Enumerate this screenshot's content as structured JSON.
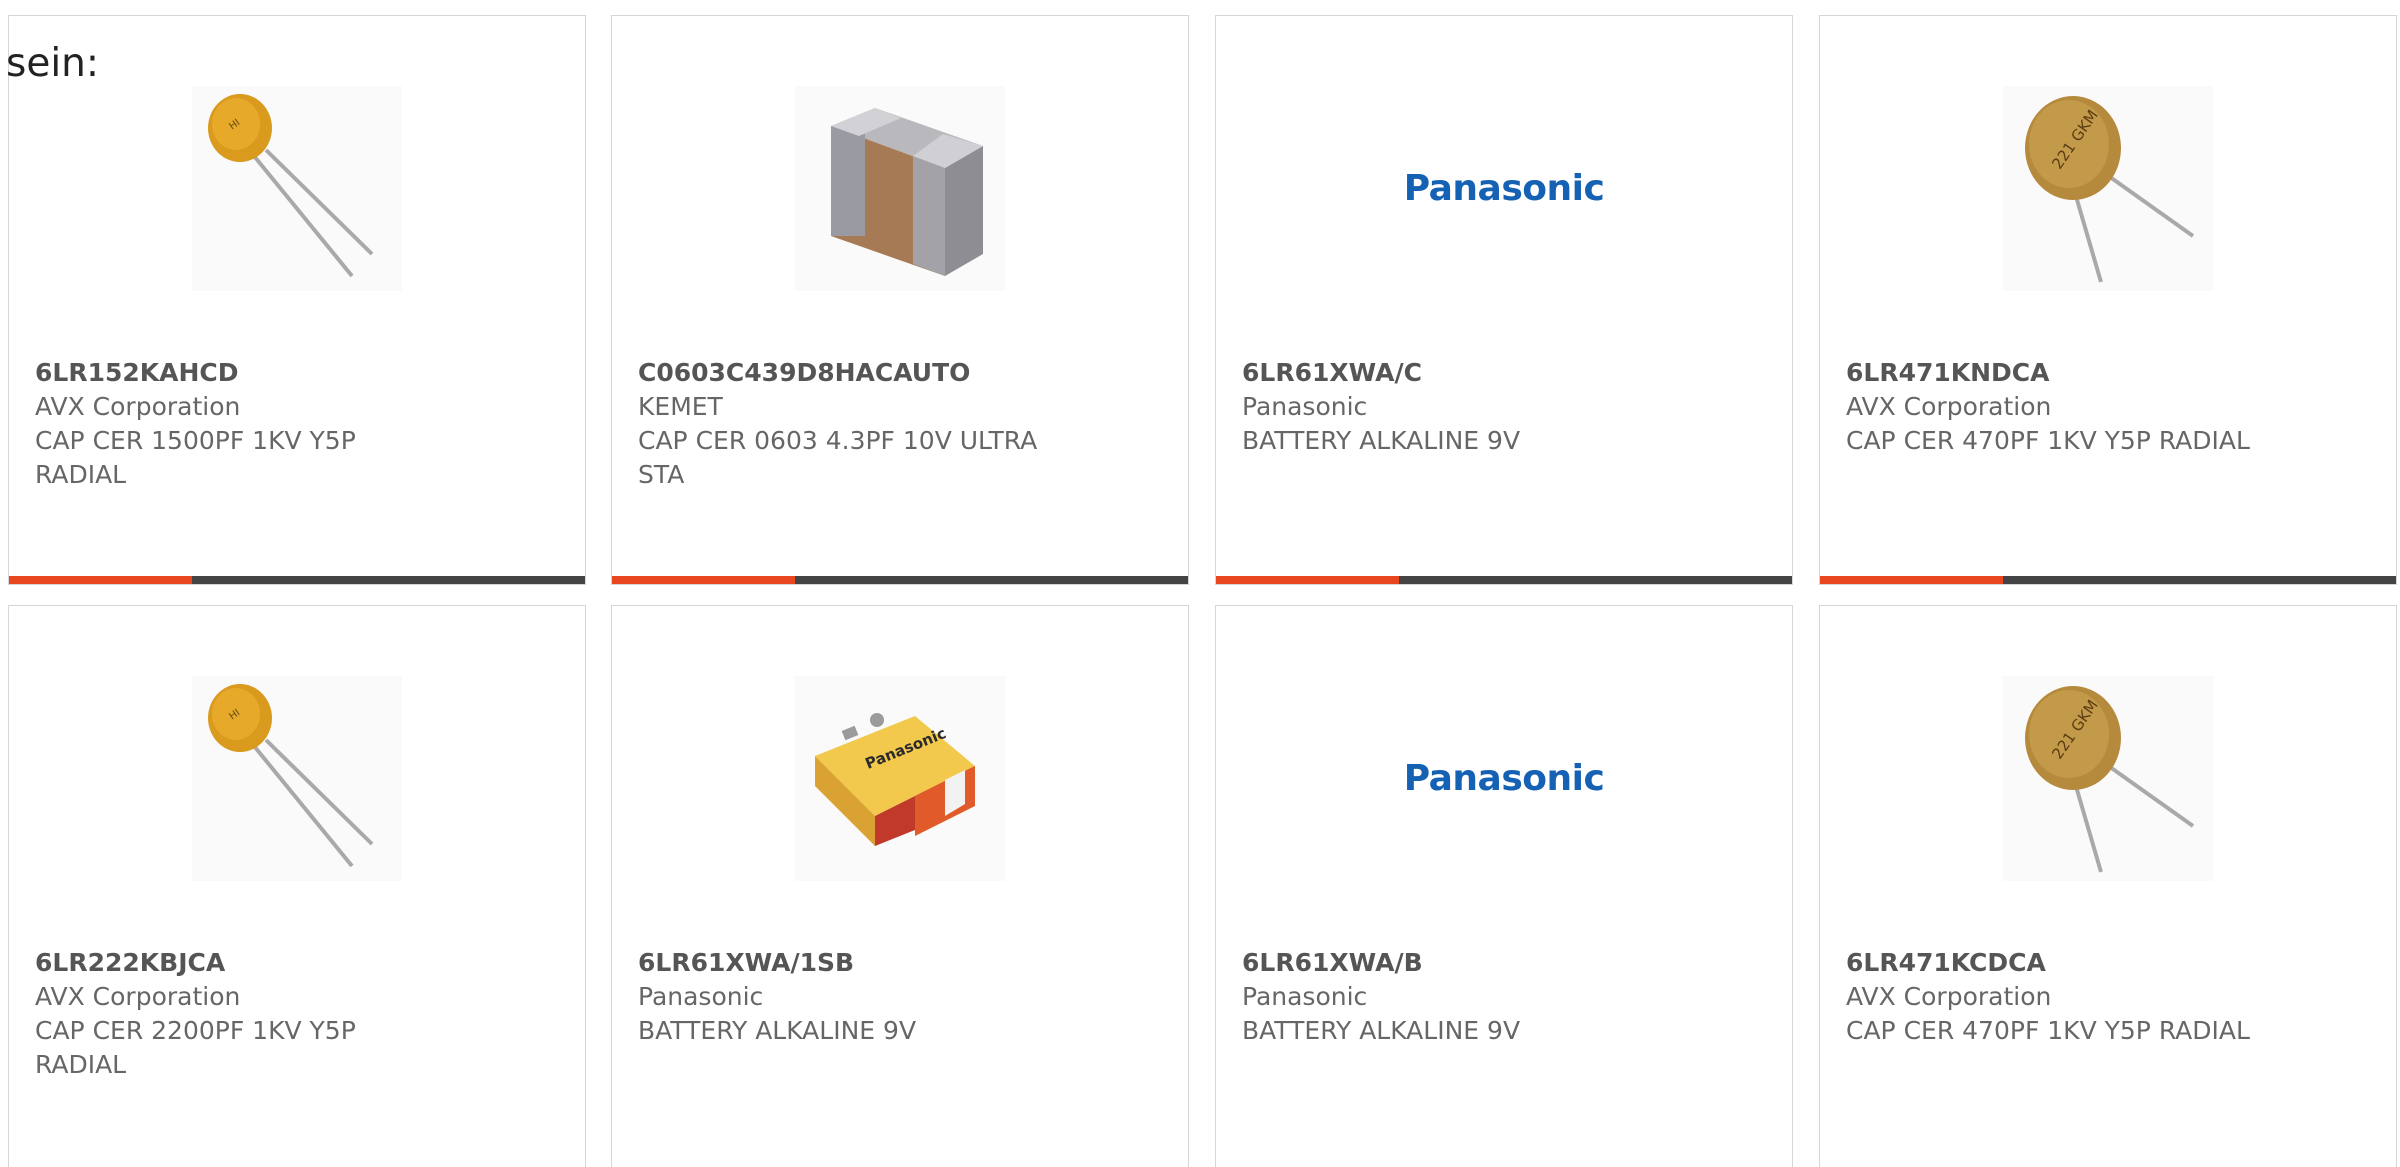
{
  "intro_text": "sein:",
  "colors": {
    "accent": "#e8461f",
    "bar_dark": "#444444",
    "panasonic_blue": "#1561b3"
  },
  "cards": [
    {
      "part": "6LR152KAHCD",
      "manufacturer": "AVX Corporation",
      "description": "CAP CER 1500PF 1KV Y5P RADIAL",
      "image": "radial-disc-capacitor-yellow-icon"
    },
    {
      "part": "C0603C439D8HACAUTO",
      "manufacturer": "KEMET",
      "description": "CAP CER 0603 4.3PF 10V ULTRA STA",
      "image": "smd-chip-capacitor-icon"
    },
    {
      "part": "6LR61XWA/C",
      "manufacturer": "Panasonic",
      "description": "BATTERY ALKALINE 9V",
      "image": "panasonic-logo",
      "logo_text": "Panasonic"
    },
    {
      "part": "6LR471KNDCA",
      "manufacturer": "AVX Corporation",
      "description": "CAP CER 470PF 1KV Y5P RADIAL",
      "image": "radial-disc-capacitor-tan-icon",
      "marking": "221 GKM"
    },
    {
      "part": "6LR222KBJCA",
      "manufacturer": "AVX Corporation",
      "description": "CAP CER 2200PF 1KV Y5P RADIAL",
      "image": "radial-disc-capacitor-yellow-icon"
    },
    {
      "part": "6LR61XWA/1SB",
      "manufacturer": "Panasonic",
      "description": "BATTERY ALKALINE 9V",
      "image": "9v-battery-icon",
      "battery_label": "Panasonic"
    },
    {
      "part": "6LR61XWA/B",
      "manufacturer": "Panasonic",
      "description": "BATTERY ALKALINE 9V",
      "image": "panasonic-logo",
      "logo_text": "Panasonic"
    },
    {
      "part": "6LR471KCDCA",
      "manufacturer": "AVX Corporation",
      "description": "CAP CER 470PF 1KV Y5P RADIAL",
      "image": "radial-disc-capacitor-tan-icon",
      "marking": "221 GKM"
    }
  ]
}
